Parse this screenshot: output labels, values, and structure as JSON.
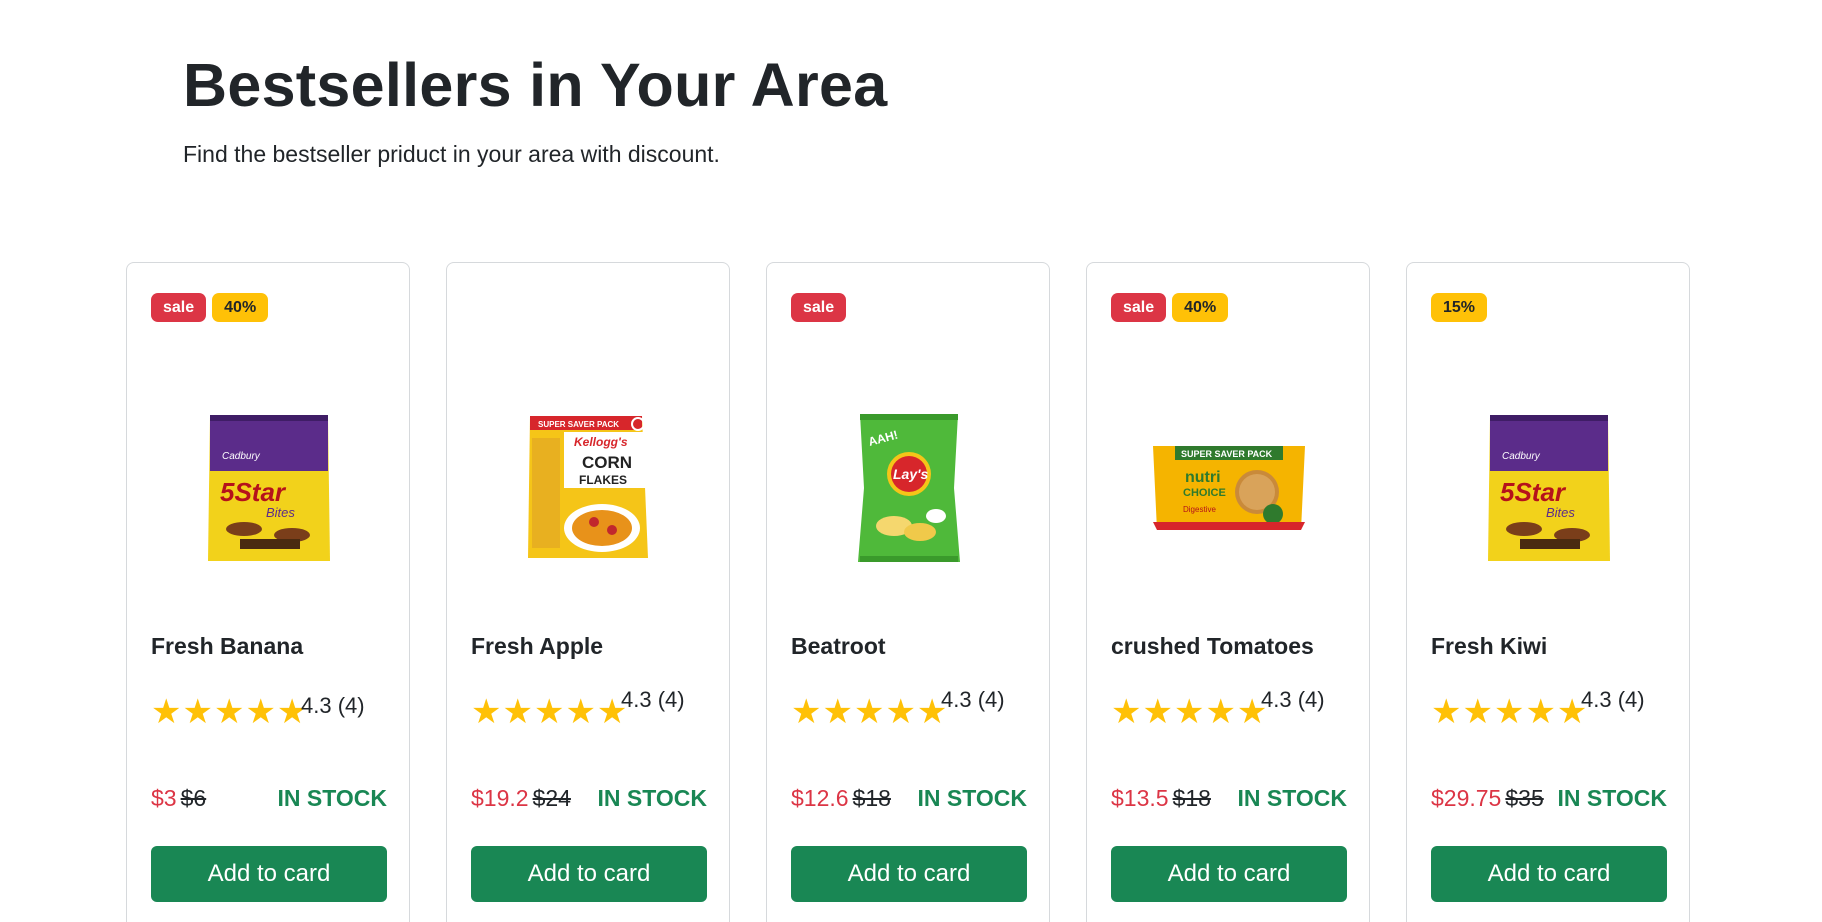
{
  "header": {
    "title": "Bestsellers in Your Area",
    "subtitle": "Find the bestseller priduct in your area with discount."
  },
  "products": [
    {
      "name": "Fresh Banana",
      "badges": [
        "sale",
        "40%"
      ],
      "image": "5star-bites-pack",
      "brand_text": "Cadbury",
      "product_text": "5Star",
      "sub_text": "Bites",
      "stars": "★★★★★",
      "rating": "4.3 (4)",
      "price": "$3",
      "old_price": "$6",
      "stock": "IN STOCK",
      "button": "Add to card"
    },
    {
      "name": "Fresh Apple",
      "badges": [],
      "image": "corn-flakes-pack",
      "banner_text": "SUPER SAVER PACK",
      "brand_text": "Kellogg's",
      "product_text": "CORN",
      "sub_text": "FLAKES",
      "stars": "★★★★★",
      "rating": "4.3 (4)",
      "price": "$19.2",
      "old_price": "$24",
      "stock": "IN STOCK",
      "button": "Add to card"
    },
    {
      "name": "Beatroot",
      "badges": [
        "sale"
      ],
      "image": "lays-chips-pack",
      "brand_text": "Lay's",
      "sub_text": "AAH!",
      "stars": "★★★★★",
      "rating": "4.3 (4)",
      "price": "$12.6",
      "old_price": "$18",
      "stock": "IN STOCK",
      "button": "Add to card"
    },
    {
      "name": "crushed Tomatoes",
      "badges": [
        "sale",
        "40%"
      ],
      "image": "nutri-choice-biscuit-pack",
      "banner_text": "SUPER SAVER PACK",
      "brand_text": "nutri",
      "product_text": "CHOICE",
      "sub_text": "Digestive",
      "stars": "★★★★★",
      "rating": "4.3 (4)",
      "price": "$13.5",
      "old_price": "$18",
      "stock": "IN STOCK",
      "button": "Add to card"
    },
    {
      "name": "Fresh Kiwi",
      "badges": [
        "15%"
      ],
      "image": "5star-bites-pack",
      "brand_text": "Cadbury",
      "product_text": "5Star",
      "sub_text": "Bites",
      "stars": "★★★★★",
      "rating": "4.3 (4)",
      "price": "$29.75",
      "old_price": "$35",
      "stock": "IN STOCK",
      "button": "Add to card"
    }
  ],
  "colors": {
    "sale": "#dc3545",
    "discount": "#ffc107",
    "stock": "#198754",
    "button": "#198754",
    "star": "#ffc107"
  }
}
